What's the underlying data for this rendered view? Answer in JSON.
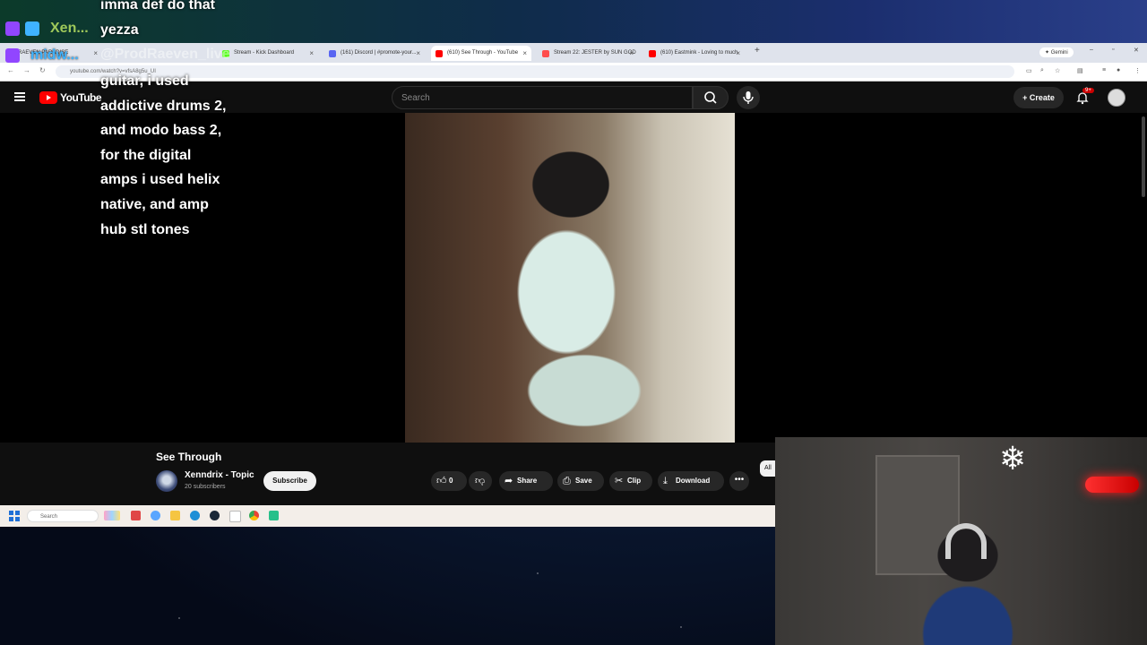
{
  "stream_overlay": {
    "chat": [
      {
        "user": "Xen...",
        "message": "imma def do that\nyezza"
      },
      {
        "user": "midw...",
        "mention": "@ProdRaeven_live",
        "message": "guitar, i used\naddictive drums 2,\nand modo bass 2,\nfor the digital\namps i used helix\nnative, and amp\nhub stl tones"
      }
    ],
    "colors": {
      "twitch": "#9146ff",
      "name_green": "#9ec85a",
      "name_blue": "#3fb3ff"
    }
  },
  "browser": {
    "tabs": [
      {
        "label": "RAEVEN PARADISE",
        "fav": "#9146ff"
      },
      {
        "label": "Stream - Kick Dashboard",
        "fav": "#53fc18"
      },
      {
        "label": "(161) Discord | #promote-your...",
        "fav": "#5865f2"
      },
      {
        "label": "(610) See Through - YouTube",
        "fav": "#ff0000",
        "active": true
      },
      {
        "label": "Stream 22: JESTER by SUN GOD",
        "fav": "#ff4d4d"
      },
      {
        "label": "(610) Eastmink - Loving to much",
        "fav": "#ff0000"
      }
    ],
    "new_tab": "+",
    "gemini_label": "Gemini",
    "url": "youtube.com/watch?v=vfsA8g5u_UI"
  },
  "youtube": {
    "logo_text": "YouTube",
    "search_placeholder": "Search",
    "create_label": "Create",
    "notif_badge": "9+",
    "video_title": "See Through",
    "channel_name": "Xenndrix - Topic",
    "subscribers": "20 subscribers",
    "subscribe_label": "Subscribe",
    "like_count": "0",
    "share_label": "Share",
    "save_label": "Save",
    "clip_label": "Clip",
    "download_label": "Download",
    "chip_all": "All",
    "icons": [
      "hamburger-icon",
      "search-icon",
      "mic-icon",
      "bell-icon",
      "like-icon",
      "dislike-icon",
      "share-icon",
      "save-icon",
      "clip-icon",
      "download-icon",
      "more-icon"
    ]
  },
  "taskbar": {
    "search_placeholder": "Search"
  }
}
